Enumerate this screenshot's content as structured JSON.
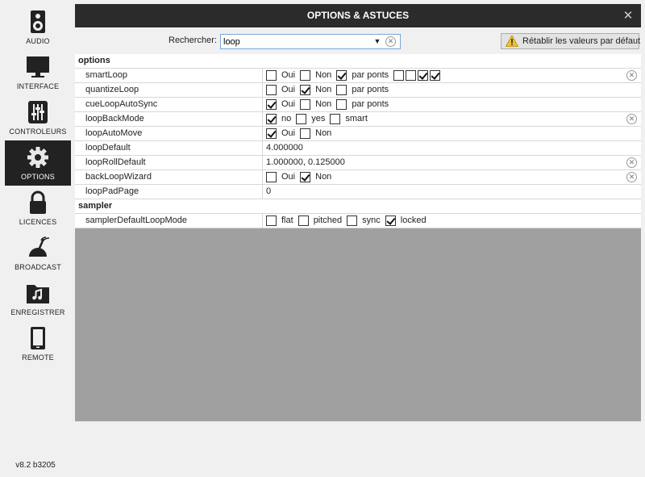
{
  "sidebar": {
    "items": [
      {
        "label": "AUDIO",
        "icon": "speaker-icon"
      },
      {
        "label": "INTERFACE",
        "icon": "monitor-icon"
      },
      {
        "label": "CONTROLEURS",
        "icon": "sliders-icon"
      },
      {
        "label": "OPTIONS",
        "icon": "gear-icon",
        "active": true
      },
      {
        "label": "LICENCES",
        "icon": "lock-icon"
      },
      {
        "label": "BROADCAST",
        "icon": "broadcast-icon"
      },
      {
        "label": "ENREGISTRER",
        "icon": "music-folder-icon"
      },
      {
        "label": "REMOTE",
        "icon": "tablet-icon"
      }
    ],
    "version": "v8.2 b3205"
  },
  "window": {
    "title": "OPTIONS & ASTUCES",
    "close_glyph": "✕"
  },
  "search": {
    "label": "Rechercher:",
    "value": "loop",
    "dropdown_glyph": "▼",
    "clear_glyph": "✕"
  },
  "reset_button": {
    "label": "Rétablir les valeurs par défaut"
  },
  "sections": [
    {
      "title": "options",
      "rows": [
        {
          "name": "smartLoop",
          "options": [
            {
              "label": "Oui",
              "checked": false
            },
            {
              "label": "Non",
              "checked": false
            },
            {
              "label": "par ponts",
              "checked": true
            }
          ],
          "extra_boxes": [
            false,
            false,
            true,
            true
          ],
          "resettable": true
        },
        {
          "name": "quantizeLoop",
          "options": [
            {
              "label": "Oui",
              "checked": false
            },
            {
              "label": "Non",
              "checked": true
            },
            {
              "label": "par ponts",
              "checked": false
            }
          ],
          "resettable": false
        },
        {
          "name": "cueLoopAutoSync",
          "options": [
            {
              "label": "Oui",
              "checked": true
            },
            {
              "label": "Non",
              "checked": false
            },
            {
              "label": "par ponts",
              "checked": false
            }
          ],
          "resettable": false
        },
        {
          "name": "loopBackMode",
          "options": [
            {
              "label": "no",
              "checked": true
            },
            {
              "label": "yes",
              "checked": false
            },
            {
              "label": "smart",
              "checked": false
            }
          ],
          "resettable": true
        },
        {
          "name": "loopAutoMove",
          "options": [
            {
              "label": "Oui",
              "checked": true
            },
            {
              "label": "Non",
              "checked": false
            }
          ],
          "resettable": false
        },
        {
          "name": "loopDefault",
          "text": "4.000000",
          "resettable": false
        },
        {
          "name": "loopRollDefault",
          "text": "1.000000, 0.125000",
          "resettable": true
        },
        {
          "name": "backLoopWizard",
          "options": [
            {
              "label": "Oui",
              "checked": false
            },
            {
              "label": "Non",
              "checked": true
            }
          ],
          "resettable": true
        },
        {
          "name": "loopPadPage",
          "text": "0",
          "resettable": false
        }
      ]
    },
    {
      "title": "sampler",
      "rows": [
        {
          "name": "samplerDefaultLoopMode",
          "options": [
            {
              "label": "flat",
              "checked": false
            },
            {
              "label": "pitched",
              "checked": false
            },
            {
              "label": "sync",
              "checked": false
            },
            {
              "label": "locked",
              "checked": true
            }
          ],
          "resettable": false
        }
      ]
    }
  ],
  "reset_glyph": "✕"
}
